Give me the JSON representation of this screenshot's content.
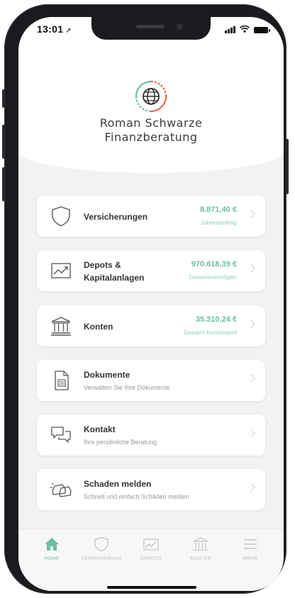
{
  "status_bar": {
    "time": "13:01"
  },
  "brand": {
    "line1": "Roman Schwarze",
    "line2": "Finanzberatung"
  },
  "cards": [
    {
      "icon": "shield-icon",
      "title": "Versicherungen",
      "amount": "8.871,40 €",
      "amount_label": "Jahresbeitrag"
    },
    {
      "icon": "chart-icon",
      "title_line1": "Depots &",
      "title_line2": "Kapitalanlagen",
      "amount": "970.618,39 €",
      "amount_label": "Gesamtvermögen"
    },
    {
      "icon": "bank-icon",
      "title": "Konten",
      "amount": "35.310,24 €",
      "amount_label": "Gesamt Kontostand"
    },
    {
      "icon": "document-icon",
      "title": "Dokumente",
      "subtitle": "Verwalten Sie Ihre Dokumente"
    },
    {
      "icon": "chat-icon",
      "title": "Kontakt",
      "subtitle": "Ihre persönliche Beratung"
    },
    {
      "icon": "car-crash-icon",
      "title": "Schaden melden",
      "subtitle": "Schnell und einfach Schäden melden"
    }
  ],
  "tabbar": [
    {
      "icon": "home-icon",
      "label": "HOME",
      "active": true
    },
    {
      "icon": "shield-icon",
      "label": "VERSICHERUNG",
      "active": false
    },
    {
      "icon": "chart-icon",
      "label": "DEPOTS",
      "active": false
    },
    {
      "icon": "bank-icon",
      "label": "KONTEN",
      "active": false
    },
    {
      "icon": "menu-icon",
      "label": "MEHR",
      "active": false
    }
  ],
  "colors": {
    "accent": "#6bbf9e",
    "text": "#333333",
    "logo_red": "#e2674b",
    "logo_green": "#6bbf9e"
  }
}
